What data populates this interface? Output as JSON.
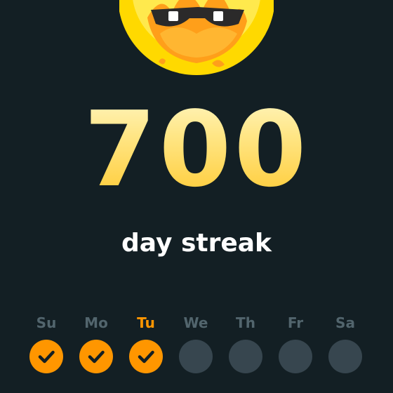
{
  "mascot": {
    "icon": "fire-mascot-with-sunglasses-icon"
  },
  "streak": {
    "count": "700",
    "label": "day streak"
  },
  "week": {
    "days": [
      {
        "label": "Su",
        "completed": true,
        "today": false
      },
      {
        "label": "Mo",
        "completed": true,
        "today": false
      },
      {
        "label": "Tu",
        "completed": true,
        "today": true
      },
      {
        "label": "We",
        "completed": false,
        "today": false
      },
      {
        "label": "Th",
        "completed": false,
        "today": false
      },
      {
        "label": "Fr",
        "completed": false,
        "today": false
      },
      {
        "label": "Sa",
        "completed": false,
        "today": false
      }
    ]
  },
  "colors": {
    "background": "#131f24",
    "streak_gold": "#ffd94a",
    "accent_orange": "#ff9600",
    "inactive_circle": "#37464f",
    "inactive_label": "#52656d"
  }
}
